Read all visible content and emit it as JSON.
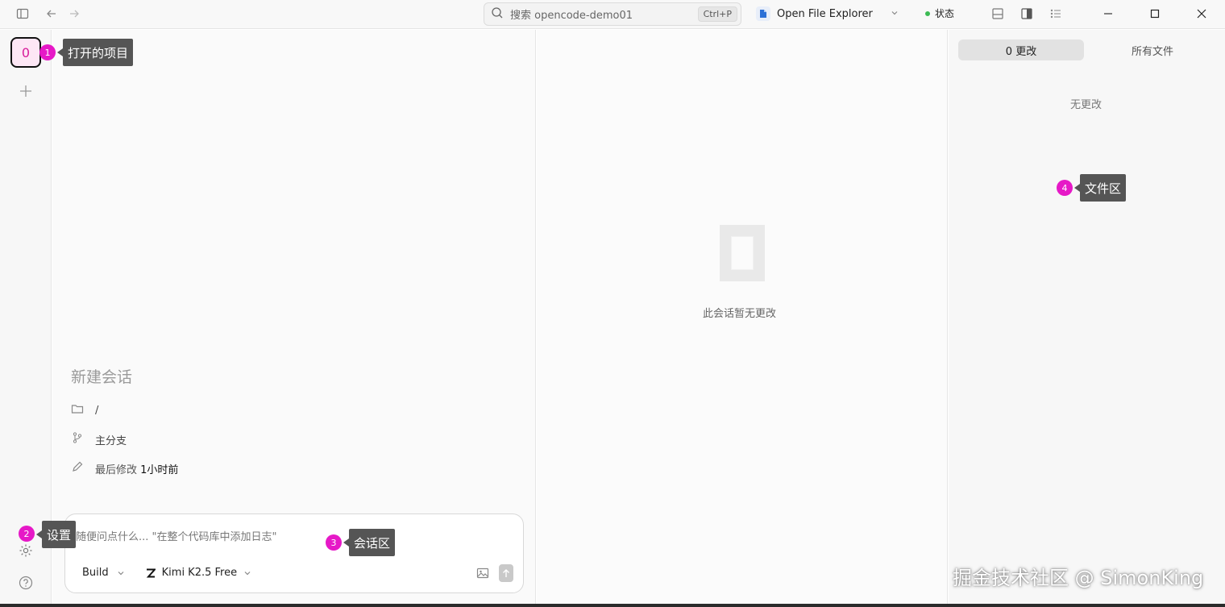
{
  "titlebar": {
    "search": {
      "placeholder": "搜索 opencode-demo01",
      "shortcut": "Ctrl+P"
    },
    "open_app": {
      "label": "Open File Explorer"
    },
    "status": {
      "label": "状态"
    }
  },
  "rail": {
    "project_letter": "0"
  },
  "conversation": {
    "new_session_title": "新建会话",
    "path": "/",
    "branch": "主分支",
    "modified_label": "最后修改",
    "modified_time": "1小时前",
    "composer": {
      "placeholder": "随便问点什么... \"在整个代码库中添加日志\"",
      "agent": "Build",
      "model": "Kimi K2.5 Free"
    }
  },
  "middle": {
    "empty_text": "此会话暂无更改"
  },
  "right_panel": {
    "tabs": [
      "0 更改",
      "所有文件"
    ],
    "empty_text": "无更改"
  },
  "annotations": [
    {
      "number": "1",
      "label": "打开的项目"
    },
    {
      "number": "2",
      "label": "设置"
    },
    {
      "number": "3",
      "label": "会话区"
    },
    {
      "number": "4",
      "label": "文件区"
    }
  ],
  "watermark": "掘金技术社区 @ SimonKing",
  "colors": {
    "accent_magenta": "#e619c7",
    "tooltip_bg": "#555555",
    "status_green": "#3cba54"
  }
}
